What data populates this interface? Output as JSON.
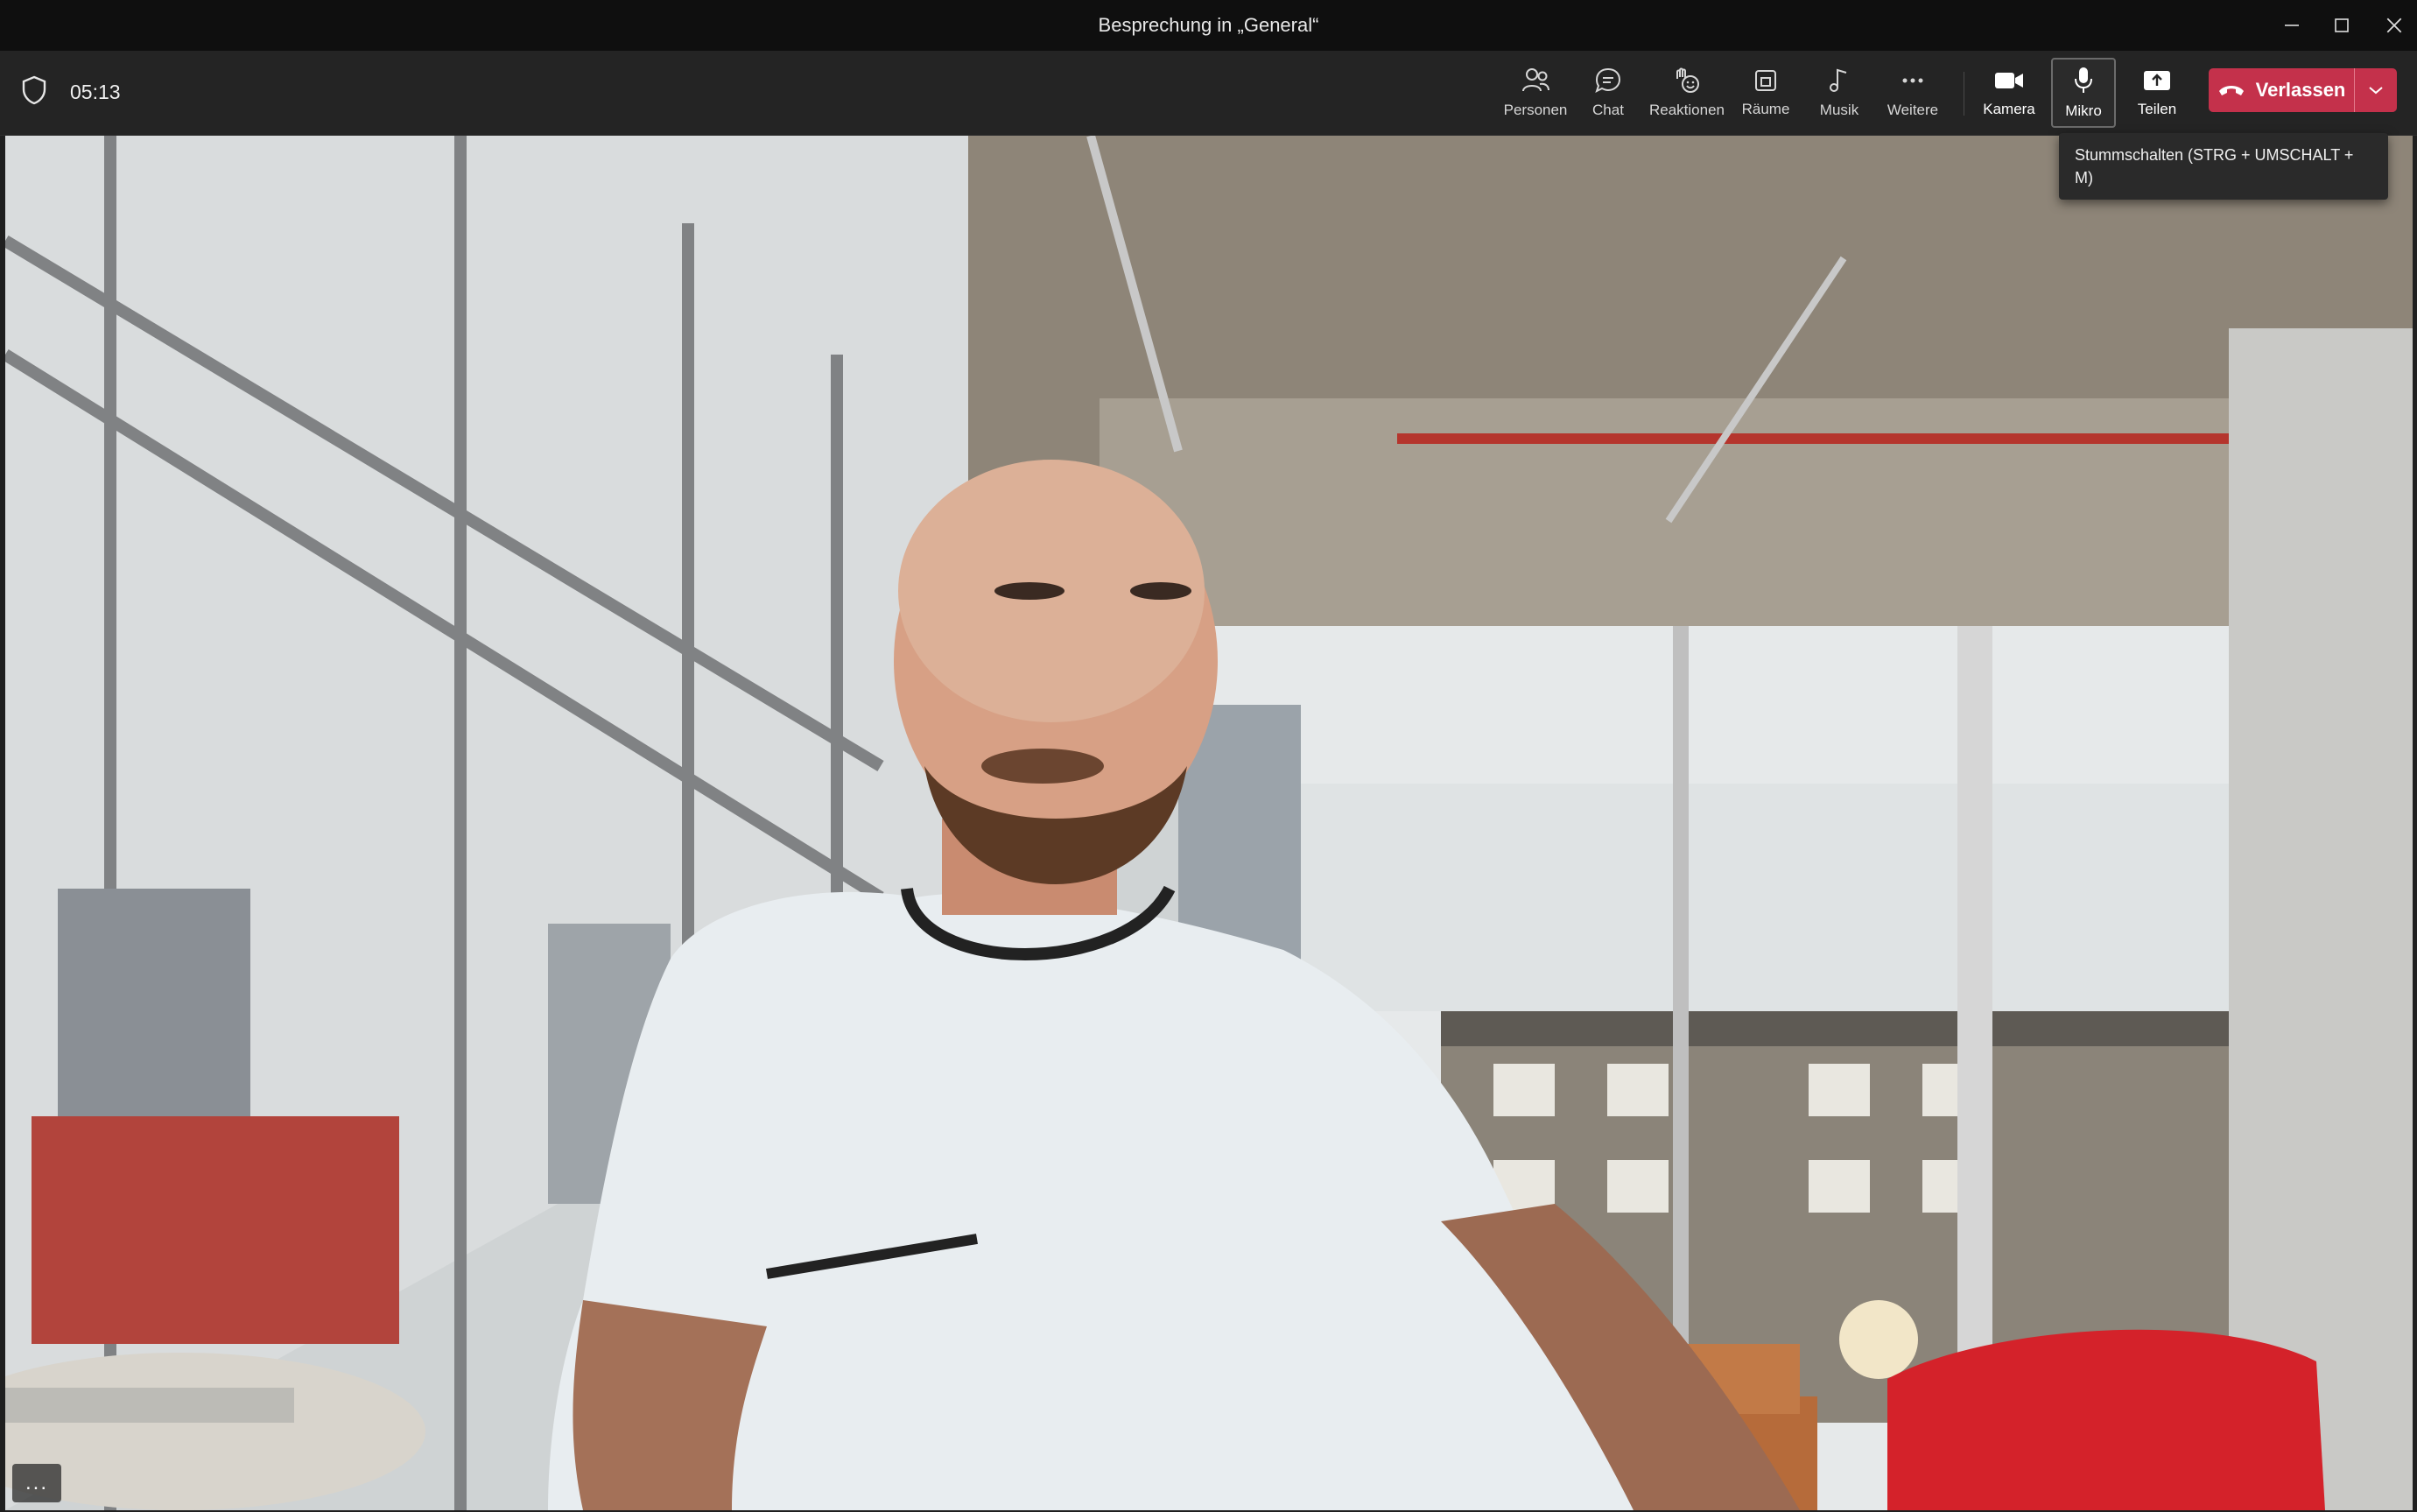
{
  "window": {
    "title": "Besprechung in „General“"
  },
  "toolbar": {
    "timer": "05:13",
    "buttons": {
      "people": "Personen",
      "chat": "Chat",
      "reactions": "Reaktionen",
      "rooms": "Räume",
      "music": "Musik",
      "more": "Weitere",
      "camera": "Kamera",
      "mic": "Mikro",
      "share": "Teilen"
    },
    "leave_label": "Verlassen"
  },
  "tooltip": {
    "text": "Stummschalten (STRG + UMSCHALT + M)"
  },
  "video": {
    "more_options": "..."
  },
  "colors": {
    "leave": "#c4314b",
    "toolbar_bg": "#242424",
    "titlebar_bg": "#0f0f0f"
  }
}
